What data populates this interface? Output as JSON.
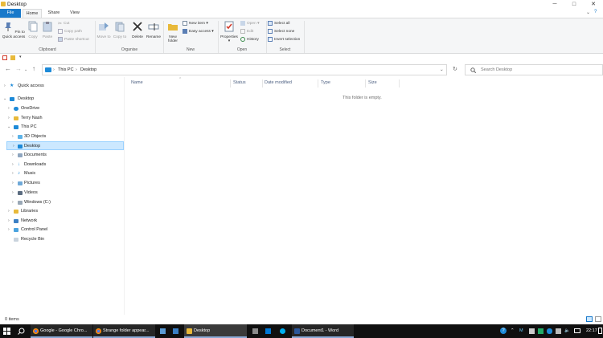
{
  "window": {
    "title": "Desktop",
    "minimize": "─",
    "maximize": "□",
    "close": "✕"
  },
  "ribbon": {
    "tabs": [
      "File",
      "Home",
      "Share",
      "View"
    ],
    "clipboard": {
      "label": "Clipboard",
      "pin": "Pin to Quick access",
      "copy": "Copy",
      "paste": "Paste",
      "cut": "Cut",
      "copy_path": "Copy path",
      "paste_shortcut": "Paste shortcut"
    },
    "organise": {
      "label": "Organise",
      "move_to": "Move to",
      "copy_to": "Copy to",
      "delete": "Delete",
      "rename": "Rename"
    },
    "new": {
      "label": "New",
      "new_folder": "New folder",
      "new_item": "New item",
      "easy_access": "Easy access"
    },
    "open": {
      "label": "Open",
      "properties": "Properties",
      "open": "Open",
      "edit": "Edit",
      "history": "History"
    },
    "select": {
      "label": "Select",
      "select_all": "Select all",
      "select_none": "Select none",
      "invert_selection": "Invert selection"
    }
  },
  "address": {
    "crumbs": [
      "This PC",
      "Desktop"
    ],
    "search_placeholder": "Search Desktop"
  },
  "nav": {
    "quick_access": "Quick access",
    "desktop": "Desktop",
    "onedrive": "OneDrive",
    "user": "Terry Nash",
    "this_pc": "This PC",
    "objects3d": "3D Objects",
    "desktop_sub": "Desktop",
    "documents": "Documents",
    "downloads": "Downloads",
    "music": "Music",
    "pictures": "Pictures",
    "videos": "Videos",
    "windows_c": "Windows (C:)",
    "libraries": "Libraries",
    "network": "Network",
    "control_panel": "Control Panel",
    "recycle_bin": "Recycle Bin"
  },
  "content": {
    "columns": [
      "Name",
      "Status",
      "Date modified",
      "Type",
      "Size"
    ],
    "empty_message": "This folder is empty."
  },
  "status": {
    "item_count": "0 items"
  },
  "taskbar": {
    "chrome": "Google - Google Chro...",
    "strange": "Strange folder appear...",
    "explorer": "Desktop",
    "word": "Document1 - Word",
    "time": "22:17"
  },
  "colors": {
    "accent": "#1979ca",
    "selection": "#cce8ff",
    "taskbar": "#101010",
    "folder": "#e8b93a"
  }
}
